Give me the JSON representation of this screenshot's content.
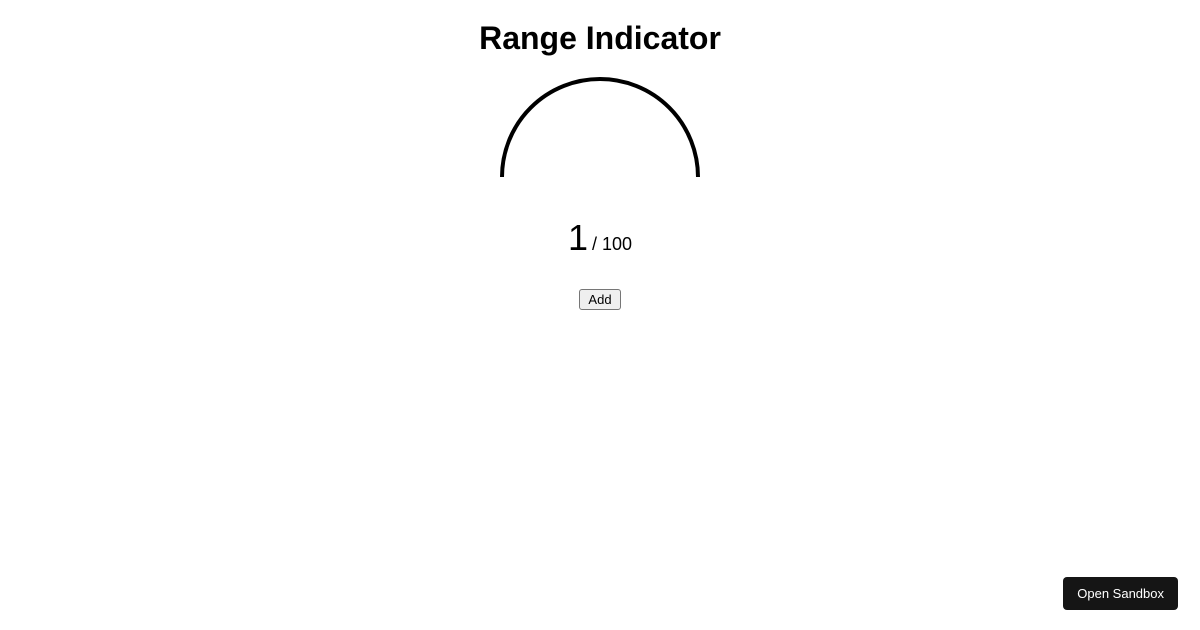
{
  "title": "Range Indicator",
  "gauge": {
    "current": "1",
    "separator": " / ",
    "max": "100"
  },
  "buttons": {
    "add": "Add",
    "sandbox": "Open Sandbox"
  }
}
